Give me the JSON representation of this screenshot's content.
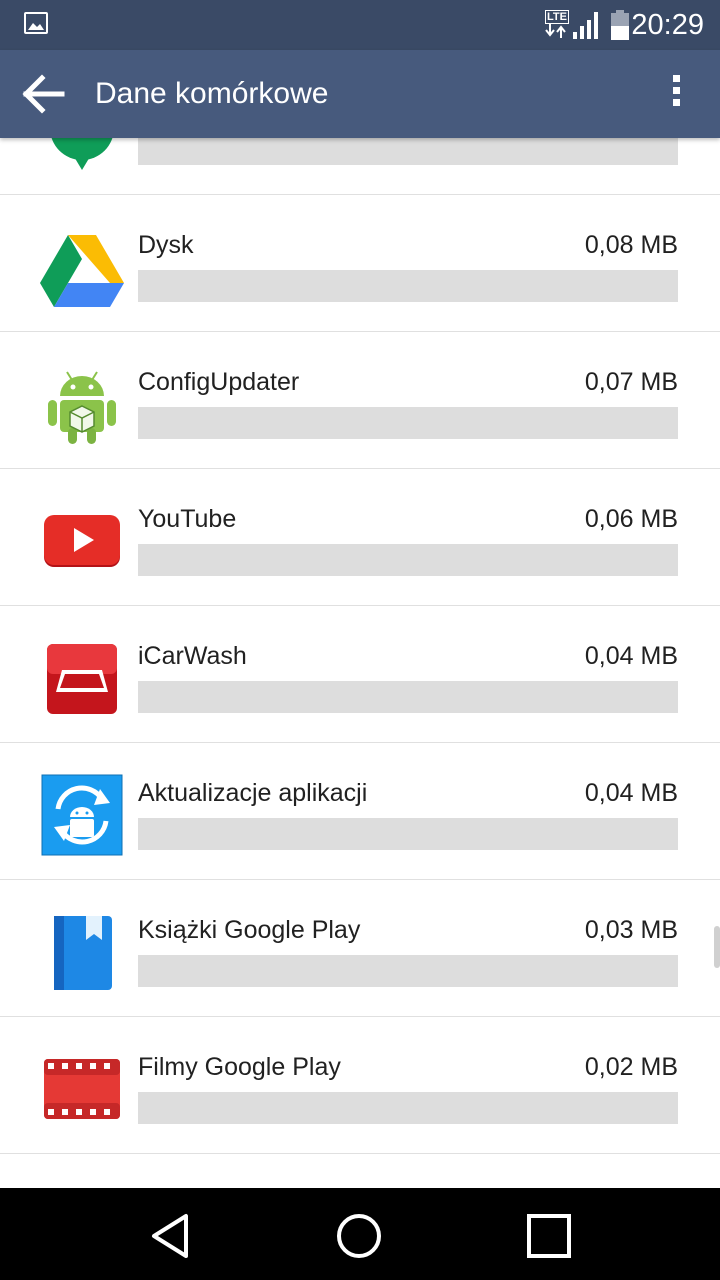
{
  "status_bar": {
    "time": "20:29",
    "network": "LTE",
    "notification_icon": "image-icon",
    "signal_icon": "signal-icon",
    "battery_icon": "battery-icon"
  },
  "app_bar": {
    "title": "Dane komórkowe",
    "back_icon": "back-arrow-icon",
    "menu_icon": "more-vert-icon",
    "color": "#475a7d"
  },
  "apps": [
    {
      "name": "",
      "size": "",
      "usage_fraction": 0,
      "icon": "hangouts-icon"
    },
    {
      "name": "Dysk",
      "size": "0,08 MB",
      "usage_fraction": 0,
      "icon": "google-drive-icon"
    },
    {
      "name": "ConfigUpdater",
      "size": "0,07 MB",
      "usage_fraction": 0,
      "icon": "android-config-icon"
    },
    {
      "name": "YouTube",
      "size": "0,06 MB",
      "usage_fraction": 0,
      "icon": "youtube-icon"
    },
    {
      "name": "iCarWash",
      "size": "0,04 MB",
      "usage_fraction": 0,
      "icon": "icarwash-icon"
    },
    {
      "name": "Aktualizacje aplikacji",
      "size": "0,04 MB",
      "usage_fraction": 0,
      "icon": "app-updates-icon"
    },
    {
      "name": "Książki Google Play",
      "size": "0,03 MB",
      "usage_fraction": 0,
      "icon": "google-play-books-icon"
    },
    {
      "name": "Filmy Google Play",
      "size": "0,02 MB",
      "usage_fraction": 0,
      "icon": "google-play-movies-icon"
    },
    {
      "name": "",
      "size": "",
      "usage_fraction": 0,
      "icon": "app-icon"
    }
  ],
  "nav_bar": {
    "back": "nav-back-icon",
    "home": "nav-home-icon",
    "recents": "nav-recents-icon"
  }
}
